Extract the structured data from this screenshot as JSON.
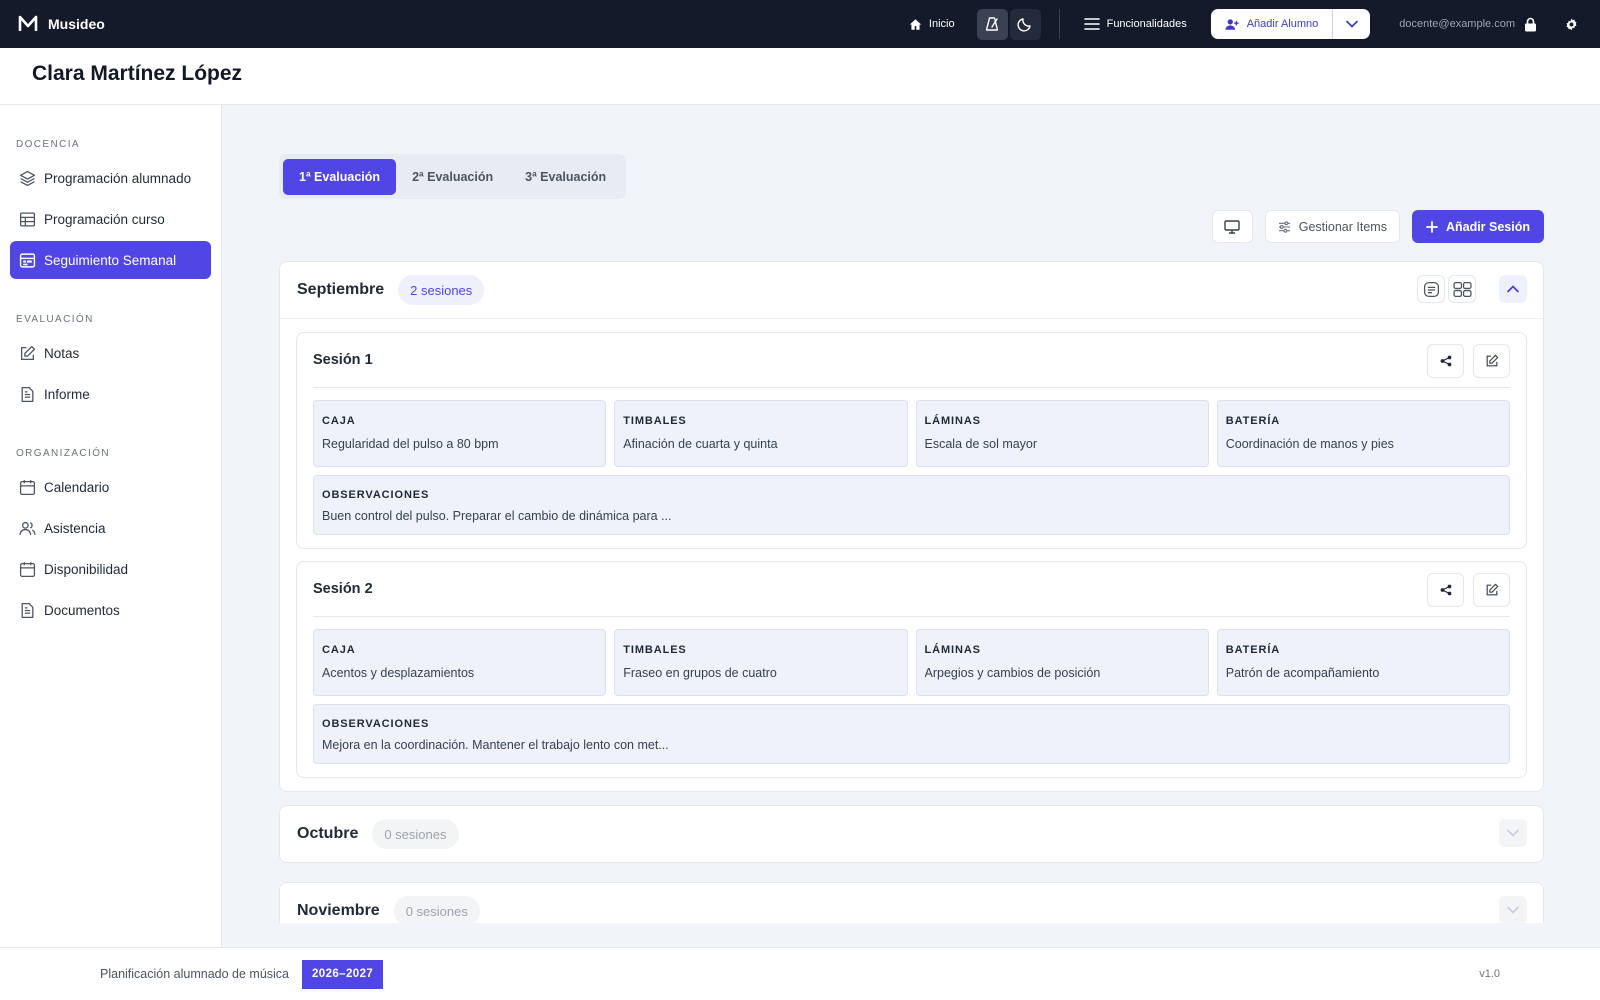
{
  "app": {
    "name": "Musideo"
  },
  "topbar": {
    "home_label": "Inicio",
    "features_label": "Funcionalidades",
    "add_student_label": "Añadir Alumno",
    "user_email": "docente@example.com"
  },
  "header": {
    "title": "Clara Martínez López"
  },
  "sidebar": {
    "sections": [
      {
        "title": "Docencia",
        "items": [
          {
            "label": "Programación alumnado",
            "icon": "layers-icon"
          },
          {
            "label": "Programación curso",
            "icon": "table-icon"
          },
          {
            "label": "Seguimiento Semanal",
            "icon": "calendar-week-icon",
            "active": true
          }
        ]
      },
      {
        "title": "Evaluación",
        "items": [
          {
            "label": "Notas",
            "icon": "edit-icon"
          },
          {
            "label": "Informe",
            "icon": "document-icon"
          }
        ]
      },
      {
        "title": "Organización",
        "items": [
          {
            "label": "Calendario",
            "icon": "calendar-icon"
          },
          {
            "label": "Asistencia",
            "icon": "users-icon"
          },
          {
            "label": "Disponibilidad",
            "icon": "calendar-icon"
          },
          {
            "label": "Documentos",
            "icon": "document-icon"
          }
        ]
      }
    ]
  },
  "tabs": [
    {
      "label": "1ª Evaluación",
      "active": true
    },
    {
      "label": "2ª Evaluación"
    },
    {
      "label": "3ª Evaluación"
    }
  ],
  "toolbar": {
    "manage_items_label": "Gestionar Items",
    "add_session_label": "Añadir Sesión"
  },
  "months": [
    {
      "name": "Septiembre",
      "badge": "2 sesiones",
      "sessions": [
        {
          "title": "Sesión 1",
          "fields": [
            {
              "label": "Caja",
              "value": "Regularidad del pulso a 80 bpm"
            },
            {
              "label": "Timbales",
              "value": "Afinación de cuarta y quinta"
            },
            {
              "label": "Láminas",
              "value": "Escala de sol mayor"
            },
            {
              "label": "Batería",
              "value": "Coordinación de manos y pies"
            }
          ],
          "observations_label": "Observaciones",
          "observations": "Buen control del pulso. Preparar el cambio de dinámica para ..."
        },
        {
          "title": "Sesión 2",
          "fields": [
            {
              "label": "Caja",
              "value": "Acentos y desplazamientos"
            },
            {
              "label": "Timbales",
              "value": "Fraseo en grupos de cuatro"
            },
            {
              "label": "Láminas",
              "value": "Arpegios y cambios de posición"
            },
            {
              "label": "Batería",
              "value": "Patrón de acompañamiento"
            }
          ],
          "observations_label": "Observaciones",
          "observations": "Mejora en la coordinación. Mantener el trabajo lento con met..."
        }
      ]
    },
    {
      "name": "Octubre",
      "badge": "0 sesiones"
    },
    {
      "name": "Noviembre",
      "badge": "0 sesiones"
    }
  ],
  "footer": {
    "text": "Planificación alumnado de música",
    "year": "2026–2027",
    "version": "v1.0"
  },
  "colors": {
    "accent": "#5046e5",
    "topbar": "#141a29"
  }
}
